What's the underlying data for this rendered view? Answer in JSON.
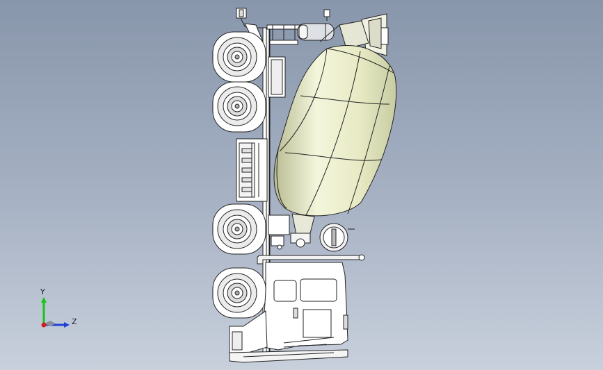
{
  "viewport": {
    "background_top": "#8896ab",
    "background_bottom": "#c8d0dc"
  },
  "model": {
    "description_icon": "concrete-mixer-truck",
    "drum_color": "#ecefcf",
    "body_color": "#ffffff",
    "line_color": "#2a2a2a"
  },
  "triad": {
    "y_label": "Y",
    "z_label": "Z",
    "y_color": "#17c417",
    "z_color": "#1f3fd6",
    "x_color": "#d41f1f"
  }
}
